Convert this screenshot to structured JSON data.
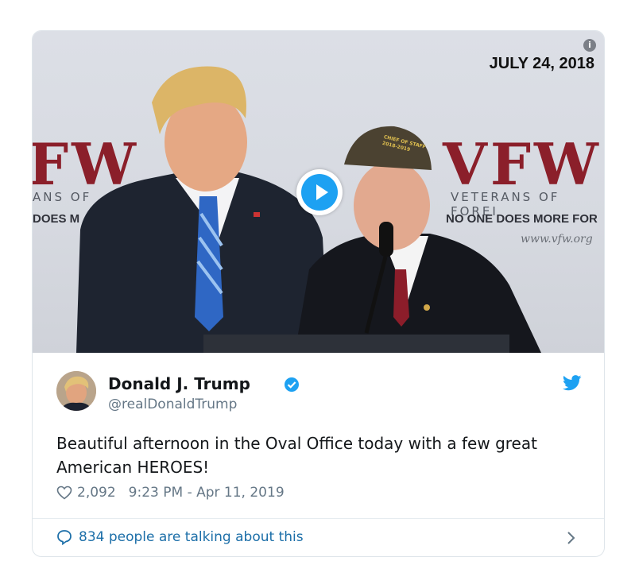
{
  "media": {
    "date_label": "JULY 24, 2018",
    "backdrop_left_logo": "FW",
    "backdrop_left_sub": "ANS OF",
    "backdrop_left_motto": "DOES M",
    "backdrop_right_logo": "VFW",
    "backdrop_right_sub": "VETERANS OF FOREI",
    "backdrop_right_motto": "NO ONE DOES MORE FOR",
    "backdrop_url": "www.vfw.org",
    "cap_text": "CHIEF OF STAFF 2018-2019",
    "info_icon": "info-icon",
    "play_icon": "play-icon"
  },
  "tweet": {
    "author_name": "Donald J. Trump",
    "author_handle": "@realDonaldTrump",
    "text": "Beautiful afternoon in the Oval Office today with a few great American HEROES!",
    "likes": "2,092",
    "timestamp": "9:23 PM - Apr 11, 2019",
    "talking": "834 people are talking about this"
  },
  "colors": {
    "accent": "#1da1f2",
    "link": "#1b6ea8",
    "secondary_text": "#657786",
    "vfw_red": "#8b1f2a"
  }
}
